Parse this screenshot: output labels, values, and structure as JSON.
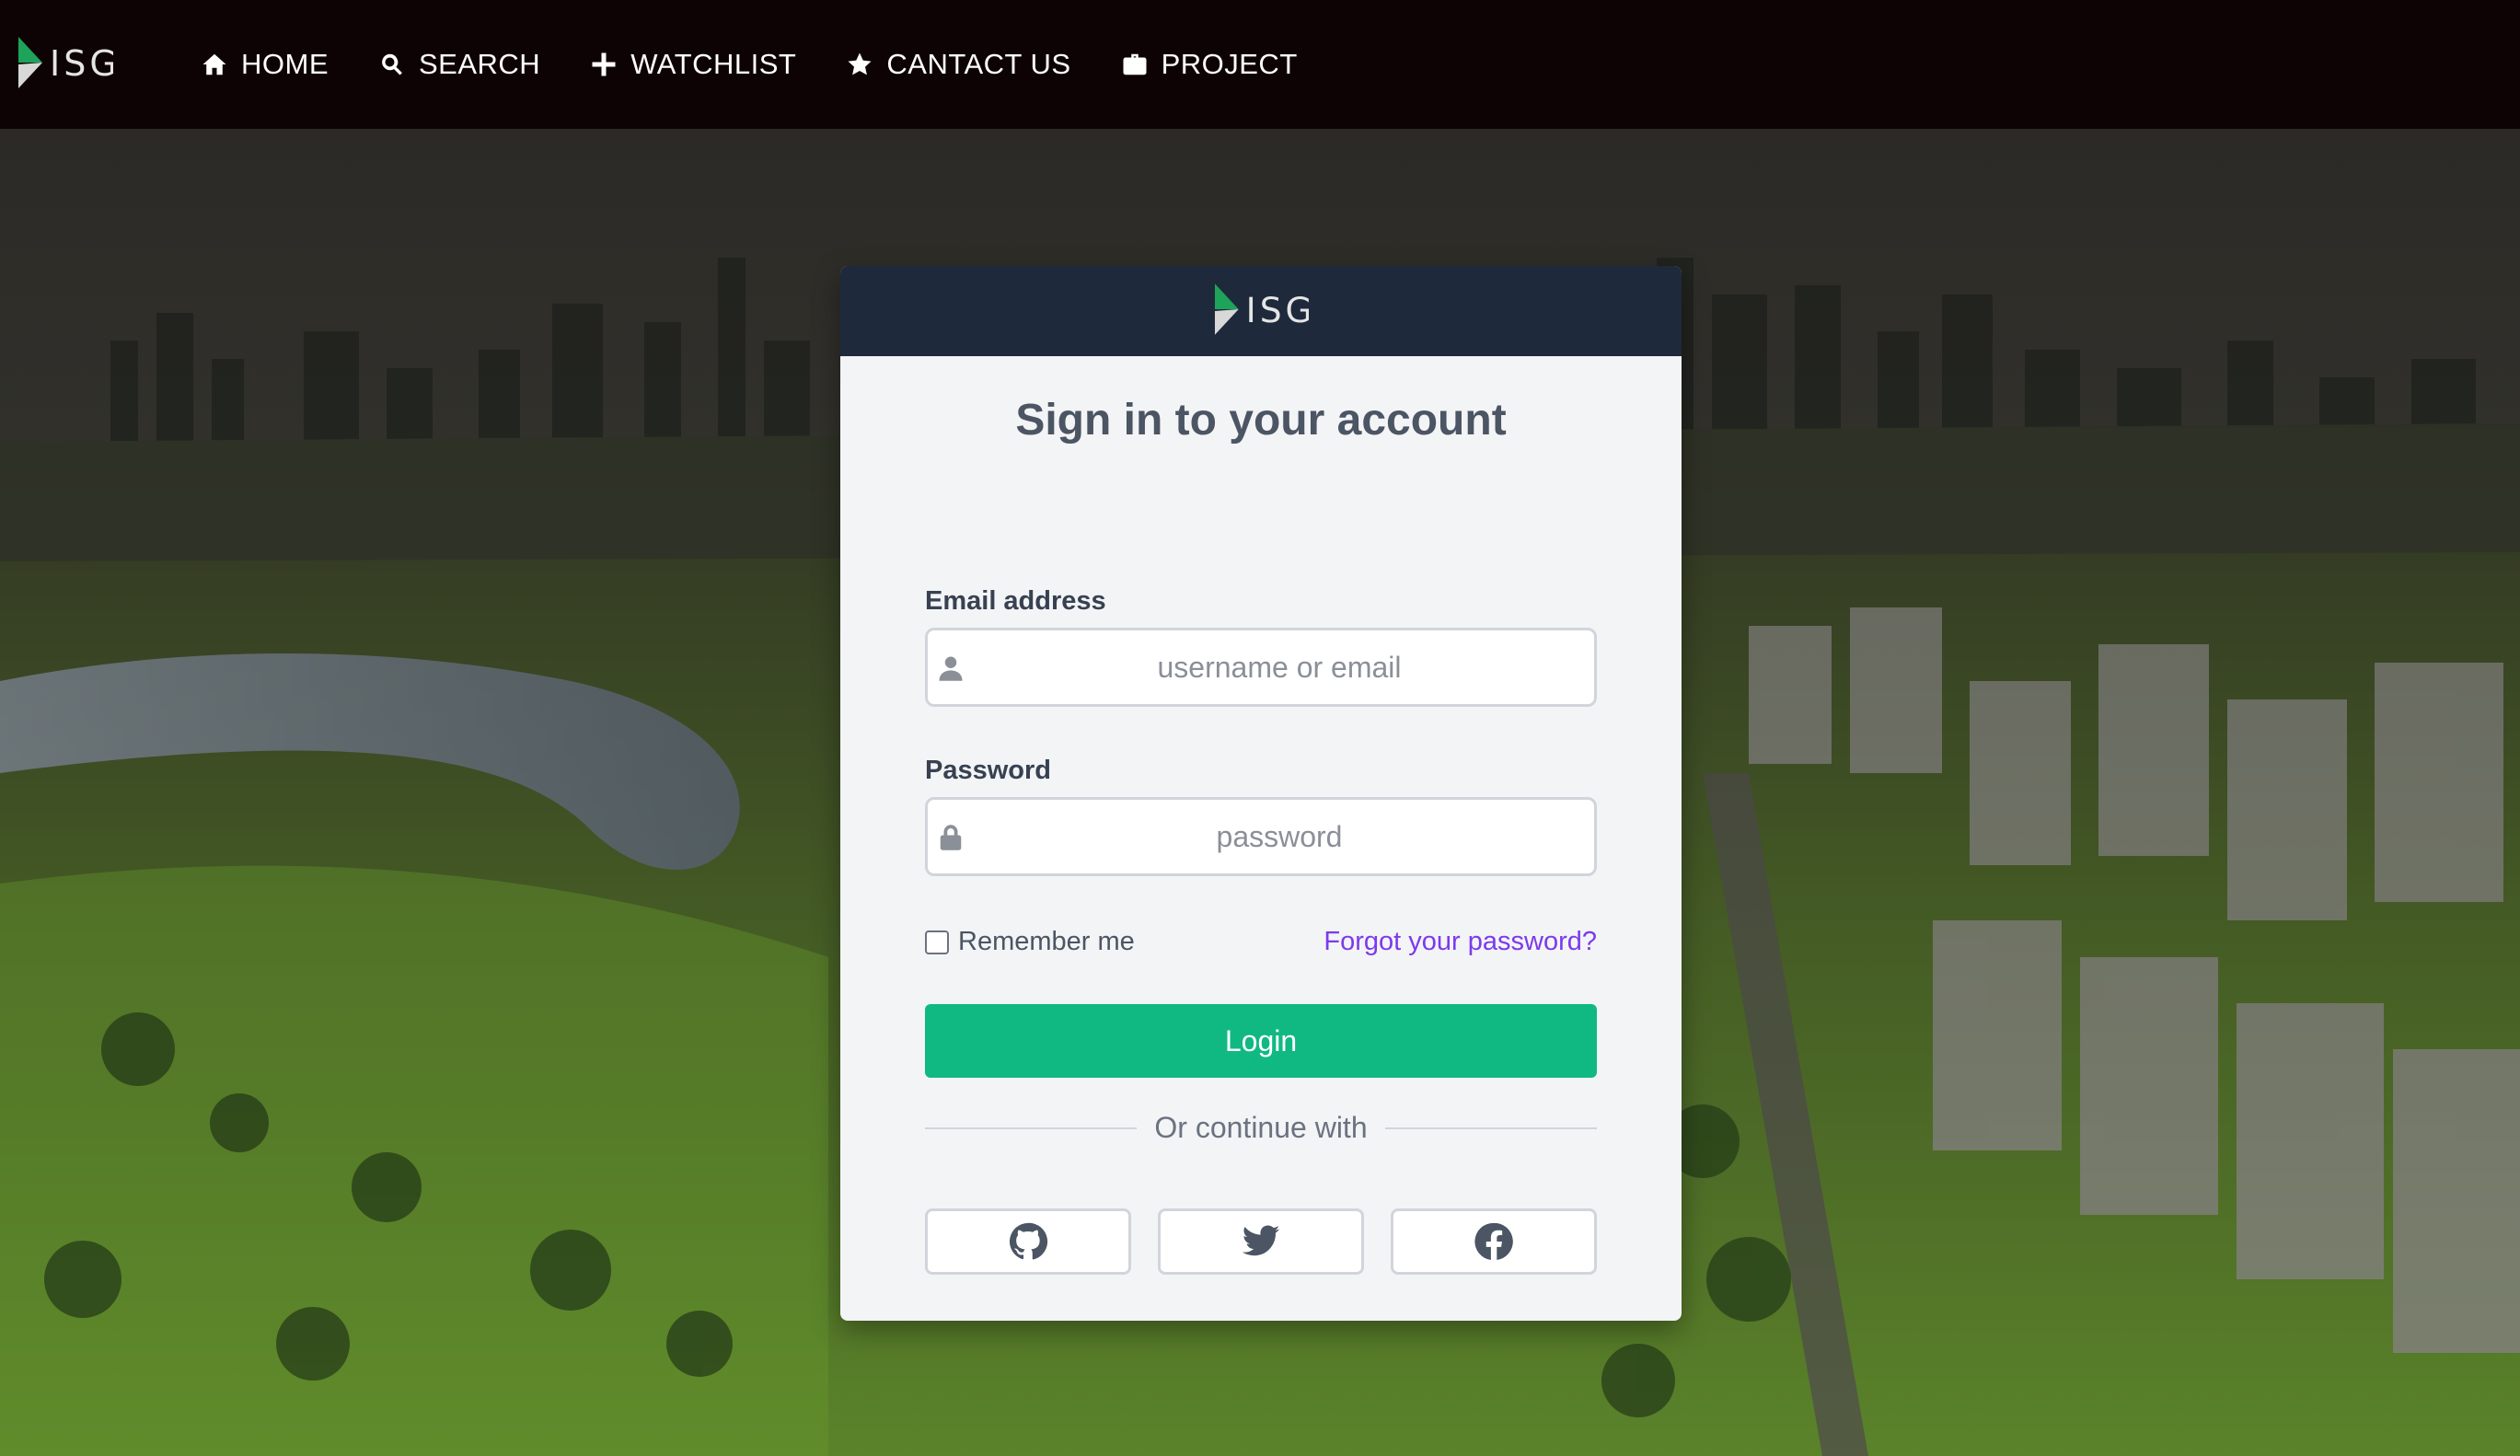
{
  "brand": {
    "logo_text": "ISG"
  },
  "nav": {
    "items": [
      {
        "label": "HOME",
        "icon": "home-icon"
      },
      {
        "label": "SEARCH",
        "icon": "search-icon"
      },
      {
        "label": "WATCHLIST",
        "icon": "plus-icon"
      },
      {
        "label": "CANTACT US",
        "icon": "star-icon"
      },
      {
        "label": "PROJECT",
        "icon": "briefcase-icon"
      }
    ]
  },
  "login": {
    "logo_text": "ISG",
    "title": "Sign in to your account",
    "email_label": "Email address",
    "email_placeholder": "username or email",
    "email_value": "",
    "password_label": "Password",
    "password_placeholder": "password",
    "password_value": "",
    "remember_label": "Remember me",
    "remember_checked": false,
    "forgot_label": "Forgot your password?",
    "login_label": "Login",
    "divider_text": "Or continue with",
    "social": [
      {
        "icon": "github-icon"
      },
      {
        "icon": "twitter-icon"
      },
      {
        "icon": "facebook-icon"
      }
    ]
  },
  "colors": {
    "navbar_bg": "#0e0304",
    "card_header_bg": "#1e293b",
    "card_bg": "#f3f4f6",
    "login_button": "#10b981",
    "forgot_link": "#7c3aed"
  }
}
